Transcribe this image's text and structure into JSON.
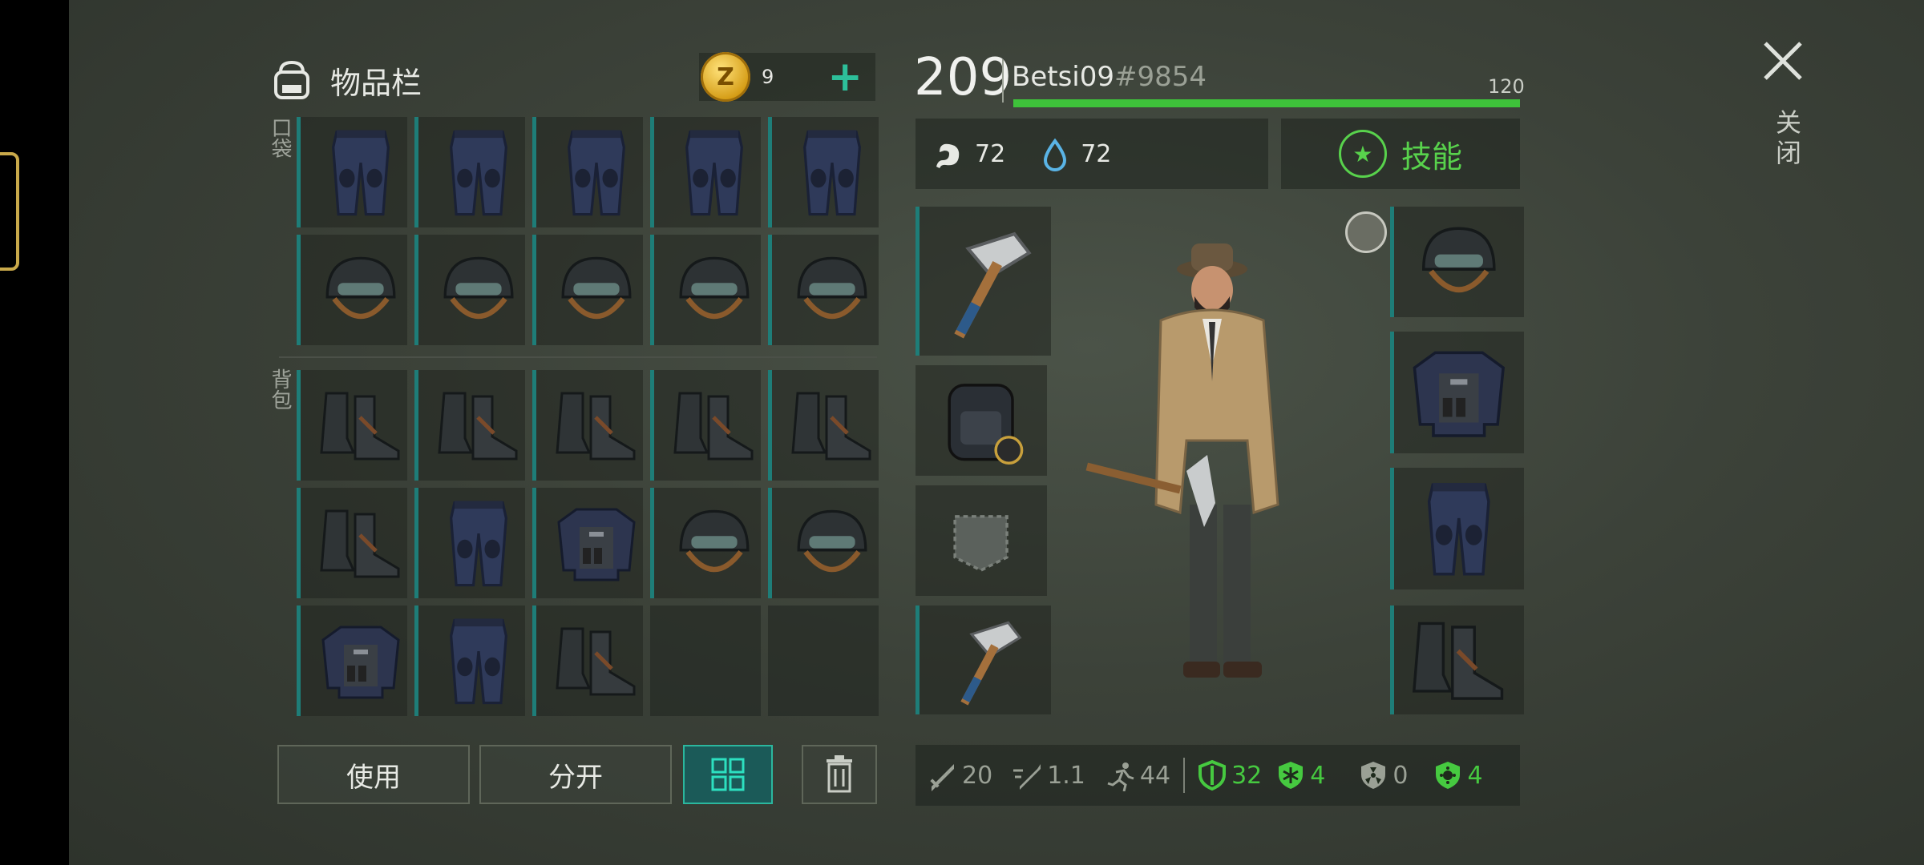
{
  "inventory": {
    "title": "物品栏",
    "coins": "9",
    "add_label": "+",
    "pocket_label": "口袋",
    "backpack_label": "背包",
    "pocket_slots": [
      "pants",
      "pants",
      "pants",
      "pants",
      "pants",
      "helmet",
      "helmet",
      "helmet",
      "helmet",
      "helmet"
    ],
    "backpack_slots": [
      "boots",
      "boots",
      "boots",
      "boots",
      "boots",
      "boots",
      "pants",
      "vest",
      "helmet",
      "helmet",
      "vest",
      "pants",
      "boots",
      "",
      ""
    ]
  },
  "actions": {
    "use_label": "使用",
    "split_label": "分开"
  },
  "player": {
    "level": "209",
    "name": "Betsi09",
    "id": "#9854",
    "xp_max": "120",
    "xp_fraction": 1.0,
    "hunger": "72",
    "thirst": "72",
    "skills_label": "技能"
  },
  "equipment": {
    "left": [
      "pickaxe",
      "backpack",
      "pocket",
      "pickaxe"
    ],
    "right": [
      "helmet",
      "vest",
      "pants",
      "boots"
    ]
  },
  "combat_stats": {
    "damage": "20",
    "attack_speed": "1.1",
    "speed": "44",
    "armor": "32",
    "cold_resist": "4",
    "radiation": "0",
    "infection": "4"
  },
  "close_label": "关闭",
  "colors": {
    "accent": "#1e7d78",
    "green": "#46c940",
    "coin": "#d49b14"
  }
}
